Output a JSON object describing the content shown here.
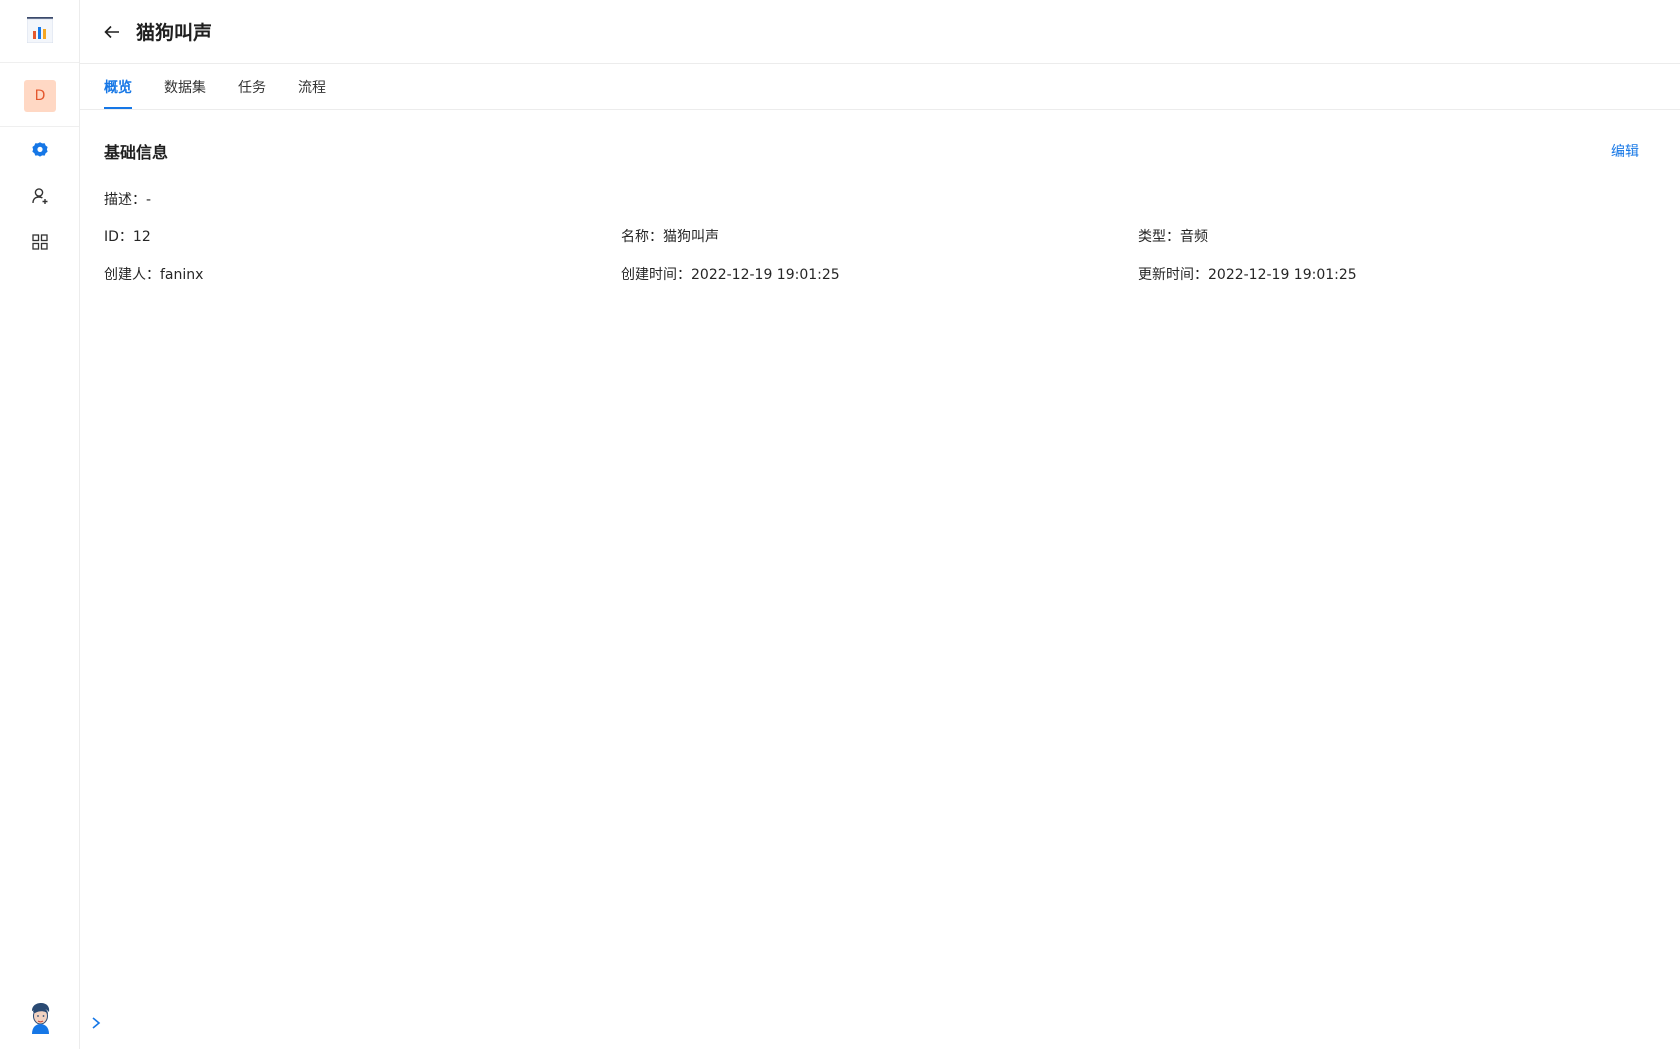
{
  "sidebar": {
    "workspace_initial": "D",
    "items": [
      {
        "name": "settings",
        "icon": "gear-icon"
      },
      {
        "name": "users",
        "icon": "user-add-icon"
      },
      {
        "name": "apps",
        "icon": "grid-icon"
      }
    ],
    "accent_color": "#1677e6"
  },
  "header": {
    "title": "猫狗叫声"
  },
  "tabs": [
    {
      "label": "概览",
      "active": true
    },
    {
      "label": "数据集",
      "active": false
    },
    {
      "label": "任务",
      "active": false
    },
    {
      "label": "流程",
      "active": false
    }
  ],
  "basic_info": {
    "title": "基础信息",
    "edit_label": "编辑",
    "description": "描述：-",
    "id": "ID：12",
    "name": "名称：猫狗叫声",
    "type": "类型：音频",
    "creator": "创建人：faninx",
    "created_at": "创建时间：2022-12-19 19:01:25",
    "updated_at": "更新时间：2022-12-19 19:01:25"
  }
}
